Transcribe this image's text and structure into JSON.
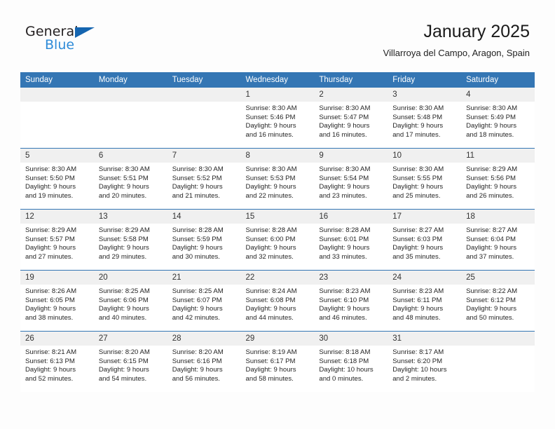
{
  "brand": {
    "name_top": "General",
    "name_bottom": "Blue",
    "triangle_icon": "brand-triangle-icon",
    "accent_color": "#1565b0",
    "blue_text_color": "#2e8bd8"
  },
  "header": {
    "title": "January 2025",
    "subtitle": "Villarroya del Campo, Aragon, Spain"
  },
  "theme": {
    "header_row_bg": "#3476b4",
    "daynum_bg": "#f0f0f0",
    "cell_bg": "#ffffff",
    "page_bg": "#fdfdfd"
  },
  "weekdays": [
    "Sunday",
    "Monday",
    "Tuesday",
    "Wednesday",
    "Thursday",
    "Friday",
    "Saturday"
  ],
  "labels": {
    "sunrise_prefix": "Sunrise:",
    "sunset_prefix": "Sunset:",
    "daylight_prefix": "Daylight:"
  },
  "weeks": [
    [
      {
        "day": "",
        "empty": true
      },
      {
        "day": "",
        "empty": true
      },
      {
        "day": "",
        "empty": true
      },
      {
        "day": "1",
        "sunrise": "Sunrise: 8:30 AM",
        "sunset": "Sunset: 5:46 PM",
        "daylight_1": "Daylight: 9 hours",
        "daylight_2": "and 16 minutes."
      },
      {
        "day": "2",
        "sunrise": "Sunrise: 8:30 AM",
        "sunset": "Sunset: 5:47 PM",
        "daylight_1": "Daylight: 9 hours",
        "daylight_2": "and 16 minutes."
      },
      {
        "day": "3",
        "sunrise": "Sunrise: 8:30 AM",
        "sunset": "Sunset: 5:48 PM",
        "daylight_1": "Daylight: 9 hours",
        "daylight_2": "and 17 minutes."
      },
      {
        "day": "4",
        "sunrise": "Sunrise: 8:30 AM",
        "sunset": "Sunset: 5:49 PM",
        "daylight_1": "Daylight: 9 hours",
        "daylight_2": "and 18 minutes."
      }
    ],
    [
      {
        "day": "5",
        "sunrise": "Sunrise: 8:30 AM",
        "sunset": "Sunset: 5:50 PM",
        "daylight_1": "Daylight: 9 hours",
        "daylight_2": "and 19 minutes."
      },
      {
        "day": "6",
        "sunrise": "Sunrise: 8:30 AM",
        "sunset": "Sunset: 5:51 PM",
        "daylight_1": "Daylight: 9 hours",
        "daylight_2": "and 20 minutes."
      },
      {
        "day": "7",
        "sunrise": "Sunrise: 8:30 AM",
        "sunset": "Sunset: 5:52 PM",
        "daylight_1": "Daylight: 9 hours",
        "daylight_2": "and 21 minutes."
      },
      {
        "day": "8",
        "sunrise": "Sunrise: 8:30 AM",
        "sunset": "Sunset: 5:53 PM",
        "daylight_1": "Daylight: 9 hours",
        "daylight_2": "and 22 minutes."
      },
      {
        "day": "9",
        "sunrise": "Sunrise: 8:30 AM",
        "sunset": "Sunset: 5:54 PM",
        "daylight_1": "Daylight: 9 hours",
        "daylight_2": "and 23 minutes."
      },
      {
        "day": "10",
        "sunrise": "Sunrise: 8:30 AM",
        "sunset": "Sunset: 5:55 PM",
        "daylight_1": "Daylight: 9 hours",
        "daylight_2": "and 25 minutes."
      },
      {
        "day": "11",
        "sunrise": "Sunrise: 8:29 AM",
        "sunset": "Sunset: 5:56 PM",
        "daylight_1": "Daylight: 9 hours",
        "daylight_2": "and 26 minutes."
      }
    ],
    [
      {
        "day": "12",
        "sunrise": "Sunrise: 8:29 AM",
        "sunset": "Sunset: 5:57 PM",
        "daylight_1": "Daylight: 9 hours",
        "daylight_2": "and 27 minutes."
      },
      {
        "day": "13",
        "sunrise": "Sunrise: 8:29 AM",
        "sunset": "Sunset: 5:58 PM",
        "daylight_1": "Daylight: 9 hours",
        "daylight_2": "and 29 minutes."
      },
      {
        "day": "14",
        "sunrise": "Sunrise: 8:28 AM",
        "sunset": "Sunset: 5:59 PM",
        "daylight_1": "Daylight: 9 hours",
        "daylight_2": "and 30 minutes."
      },
      {
        "day": "15",
        "sunrise": "Sunrise: 8:28 AM",
        "sunset": "Sunset: 6:00 PM",
        "daylight_1": "Daylight: 9 hours",
        "daylight_2": "and 32 minutes."
      },
      {
        "day": "16",
        "sunrise": "Sunrise: 8:28 AM",
        "sunset": "Sunset: 6:01 PM",
        "daylight_1": "Daylight: 9 hours",
        "daylight_2": "and 33 minutes."
      },
      {
        "day": "17",
        "sunrise": "Sunrise: 8:27 AM",
        "sunset": "Sunset: 6:03 PM",
        "daylight_1": "Daylight: 9 hours",
        "daylight_2": "and 35 minutes."
      },
      {
        "day": "18",
        "sunrise": "Sunrise: 8:27 AM",
        "sunset": "Sunset: 6:04 PM",
        "daylight_1": "Daylight: 9 hours",
        "daylight_2": "and 37 minutes."
      }
    ],
    [
      {
        "day": "19",
        "sunrise": "Sunrise: 8:26 AM",
        "sunset": "Sunset: 6:05 PM",
        "daylight_1": "Daylight: 9 hours",
        "daylight_2": "and 38 minutes."
      },
      {
        "day": "20",
        "sunrise": "Sunrise: 8:25 AM",
        "sunset": "Sunset: 6:06 PM",
        "daylight_1": "Daylight: 9 hours",
        "daylight_2": "and 40 minutes."
      },
      {
        "day": "21",
        "sunrise": "Sunrise: 8:25 AM",
        "sunset": "Sunset: 6:07 PM",
        "daylight_1": "Daylight: 9 hours",
        "daylight_2": "and 42 minutes."
      },
      {
        "day": "22",
        "sunrise": "Sunrise: 8:24 AM",
        "sunset": "Sunset: 6:08 PM",
        "daylight_1": "Daylight: 9 hours",
        "daylight_2": "and 44 minutes."
      },
      {
        "day": "23",
        "sunrise": "Sunrise: 8:23 AM",
        "sunset": "Sunset: 6:10 PM",
        "daylight_1": "Daylight: 9 hours",
        "daylight_2": "and 46 minutes."
      },
      {
        "day": "24",
        "sunrise": "Sunrise: 8:23 AM",
        "sunset": "Sunset: 6:11 PM",
        "daylight_1": "Daylight: 9 hours",
        "daylight_2": "and 48 minutes."
      },
      {
        "day": "25",
        "sunrise": "Sunrise: 8:22 AM",
        "sunset": "Sunset: 6:12 PM",
        "daylight_1": "Daylight: 9 hours",
        "daylight_2": "and 50 minutes."
      }
    ],
    [
      {
        "day": "26",
        "sunrise": "Sunrise: 8:21 AM",
        "sunset": "Sunset: 6:13 PM",
        "daylight_1": "Daylight: 9 hours",
        "daylight_2": "and 52 minutes."
      },
      {
        "day": "27",
        "sunrise": "Sunrise: 8:20 AM",
        "sunset": "Sunset: 6:15 PM",
        "daylight_1": "Daylight: 9 hours",
        "daylight_2": "and 54 minutes."
      },
      {
        "day": "28",
        "sunrise": "Sunrise: 8:20 AM",
        "sunset": "Sunset: 6:16 PM",
        "daylight_1": "Daylight: 9 hours",
        "daylight_2": "and 56 minutes."
      },
      {
        "day": "29",
        "sunrise": "Sunrise: 8:19 AM",
        "sunset": "Sunset: 6:17 PM",
        "daylight_1": "Daylight: 9 hours",
        "daylight_2": "and 58 minutes."
      },
      {
        "day": "30",
        "sunrise": "Sunrise: 8:18 AM",
        "sunset": "Sunset: 6:18 PM",
        "daylight_1": "Daylight: 10 hours",
        "daylight_2": "and 0 minutes."
      },
      {
        "day": "31",
        "sunrise": "Sunrise: 8:17 AM",
        "sunset": "Sunset: 6:20 PM",
        "daylight_1": "Daylight: 10 hours",
        "daylight_2": "and 2 minutes."
      },
      {
        "day": "",
        "empty": true
      }
    ]
  ]
}
